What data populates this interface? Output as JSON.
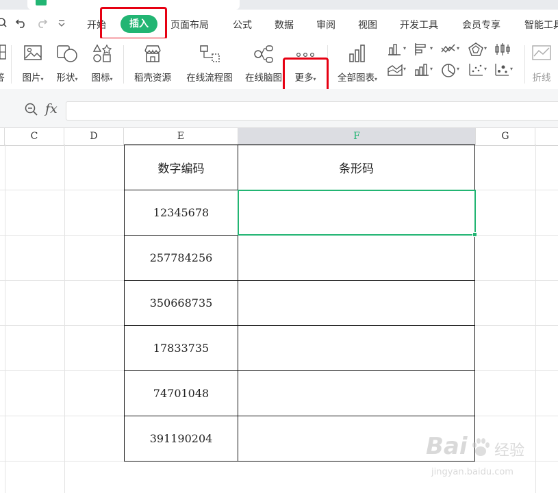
{
  "colors": {
    "accent": "#22b573",
    "highlight": "#e60012"
  },
  "menubar": {
    "items": [
      "开始",
      "插入",
      "页面布局",
      "公式",
      "数据",
      "审阅",
      "视图",
      "开发工具",
      "会员专享",
      "智能工具"
    ],
    "active": "插入"
  },
  "ribbon": {
    "partial_label": "答",
    "buttons": [
      "图片",
      "形状",
      "图标",
      "稻壳资源",
      "在线流程图",
      "在线脑图",
      "更多",
      "全部图表",
      "折线"
    ]
  },
  "formula_bar": {
    "fx": "fx",
    "value": ""
  },
  "columns": [
    "C",
    "D",
    "E",
    "F",
    "G"
  ],
  "selected_column": "F",
  "table": {
    "headers": [
      "数字编码",
      "条形码"
    ],
    "rows": [
      {
        "code": "12345678",
        "barcode": ""
      },
      {
        "code": "257784256",
        "barcode": ""
      },
      {
        "code": "350668735",
        "barcode": ""
      },
      {
        "code": "17833735",
        "barcode": ""
      },
      {
        "code": "74701048",
        "barcode": ""
      },
      {
        "code": "391190204",
        "barcode": ""
      }
    ]
  },
  "watermark": {
    "brand": "Bai",
    "brand2": "经验",
    "url": "jingyan.baidu.com"
  }
}
